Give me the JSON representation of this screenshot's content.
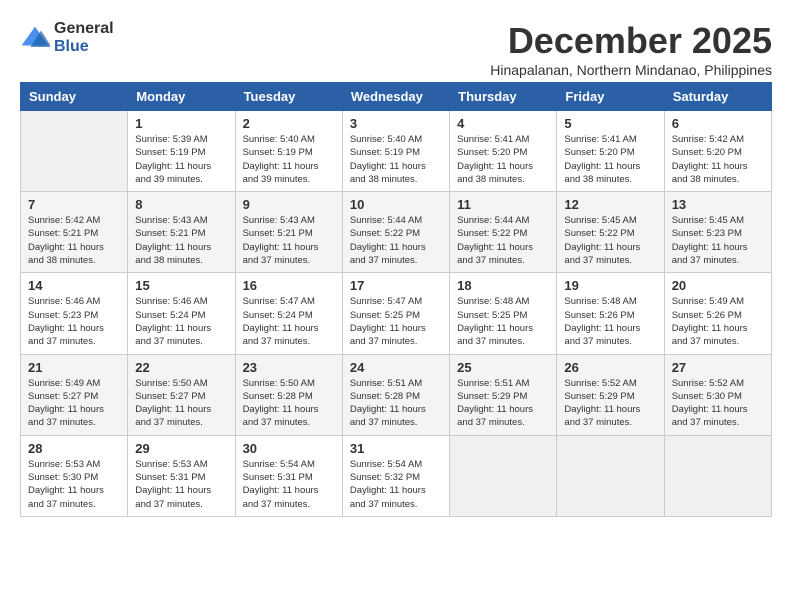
{
  "logo": {
    "general": "General",
    "blue": "Blue"
  },
  "title": "December 2025",
  "location": "Hinapalanan, Northern Mindanao, Philippines",
  "headers": [
    "Sunday",
    "Monday",
    "Tuesday",
    "Wednesday",
    "Thursday",
    "Friday",
    "Saturday"
  ],
  "weeks": [
    [
      {
        "day": "",
        "info": ""
      },
      {
        "day": "1",
        "info": "Sunrise: 5:39 AM\nSunset: 5:19 PM\nDaylight: 11 hours\nand 39 minutes."
      },
      {
        "day": "2",
        "info": "Sunrise: 5:40 AM\nSunset: 5:19 PM\nDaylight: 11 hours\nand 39 minutes."
      },
      {
        "day": "3",
        "info": "Sunrise: 5:40 AM\nSunset: 5:19 PM\nDaylight: 11 hours\nand 38 minutes."
      },
      {
        "day": "4",
        "info": "Sunrise: 5:41 AM\nSunset: 5:20 PM\nDaylight: 11 hours\nand 38 minutes."
      },
      {
        "day": "5",
        "info": "Sunrise: 5:41 AM\nSunset: 5:20 PM\nDaylight: 11 hours\nand 38 minutes."
      },
      {
        "day": "6",
        "info": "Sunrise: 5:42 AM\nSunset: 5:20 PM\nDaylight: 11 hours\nand 38 minutes."
      }
    ],
    [
      {
        "day": "7",
        "info": "Sunrise: 5:42 AM\nSunset: 5:21 PM\nDaylight: 11 hours\nand 38 minutes."
      },
      {
        "day": "8",
        "info": "Sunrise: 5:43 AM\nSunset: 5:21 PM\nDaylight: 11 hours\nand 38 minutes."
      },
      {
        "day": "9",
        "info": "Sunrise: 5:43 AM\nSunset: 5:21 PM\nDaylight: 11 hours\nand 37 minutes."
      },
      {
        "day": "10",
        "info": "Sunrise: 5:44 AM\nSunset: 5:22 PM\nDaylight: 11 hours\nand 37 minutes."
      },
      {
        "day": "11",
        "info": "Sunrise: 5:44 AM\nSunset: 5:22 PM\nDaylight: 11 hours\nand 37 minutes."
      },
      {
        "day": "12",
        "info": "Sunrise: 5:45 AM\nSunset: 5:22 PM\nDaylight: 11 hours\nand 37 minutes."
      },
      {
        "day": "13",
        "info": "Sunrise: 5:45 AM\nSunset: 5:23 PM\nDaylight: 11 hours\nand 37 minutes."
      }
    ],
    [
      {
        "day": "14",
        "info": "Sunrise: 5:46 AM\nSunset: 5:23 PM\nDaylight: 11 hours\nand 37 minutes."
      },
      {
        "day": "15",
        "info": "Sunrise: 5:46 AM\nSunset: 5:24 PM\nDaylight: 11 hours\nand 37 minutes."
      },
      {
        "day": "16",
        "info": "Sunrise: 5:47 AM\nSunset: 5:24 PM\nDaylight: 11 hours\nand 37 minutes."
      },
      {
        "day": "17",
        "info": "Sunrise: 5:47 AM\nSunset: 5:25 PM\nDaylight: 11 hours\nand 37 minutes."
      },
      {
        "day": "18",
        "info": "Sunrise: 5:48 AM\nSunset: 5:25 PM\nDaylight: 11 hours\nand 37 minutes."
      },
      {
        "day": "19",
        "info": "Sunrise: 5:48 AM\nSunset: 5:26 PM\nDaylight: 11 hours\nand 37 minutes."
      },
      {
        "day": "20",
        "info": "Sunrise: 5:49 AM\nSunset: 5:26 PM\nDaylight: 11 hours\nand 37 minutes."
      }
    ],
    [
      {
        "day": "21",
        "info": "Sunrise: 5:49 AM\nSunset: 5:27 PM\nDaylight: 11 hours\nand 37 minutes."
      },
      {
        "day": "22",
        "info": "Sunrise: 5:50 AM\nSunset: 5:27 PM\nDaylight: 11 hours\nand 37 minutes."
      },
      {
        "day": "23",
        "info": "Sunrise: 5:50 AM\nSunset: 5:28 PM\nDaylight: 11 hours\nand 37 minutes."
      },
      {
        "day": "24",
        "info": "Sunrise: 5:51 AM\nSunset: 5:28 PM\nDaylight: 11 hours\nand 37 minutes."
      },
      {
        "day": "25",
        "info": "Sunrise: 5:51 AM\nSunset: 5:29 PM\nDaylight: 11 hours\nand 37 minutes."
      },
      {
        "day": "26",
        "info": "Sunrise: 5:52 AM\nSunset: 5:29 PM\nDaylight: 11 hours\nand 37 minutes."
      },
      {
        "day": "27",
        "info": "Sunrise: 5:52 AM\nSunset: 5:30 PM\nDaylight: 11 hours\nand 37 minutes."
      }
    ],
    [
      {
        "day": "28",
        "info": "Sunrise: 5:53 AM\nSunset: 5:30 PM\nDaylight: 11 hours\nand 37 minutes."
      },
      {
        "day": "29",
        "info": "Sunrise: 5:53 AM\nSunset: 5:31 PM\nDaylight: 11 hours\nand 37 minutes."
      },
      {
        "day": "30",
        "info": "Sunrise: 5:54 AM\nSunset: 5:31 PM\nDaylight: 11 hours\nand 37 minutes."
      },
      {
        "day": "31",
        "info": "Sunrise: 5:54 AM\nSunset: 5:32 PM\nDaylight: 11 hours\nand 37 minutes."
      },
      {
        "day": "",
        "info": ""
      },
      {
        "day": "",
        "info": ""
      },
      {
        "day": "",
        "info": ""
      }
    ]
  ]
}
